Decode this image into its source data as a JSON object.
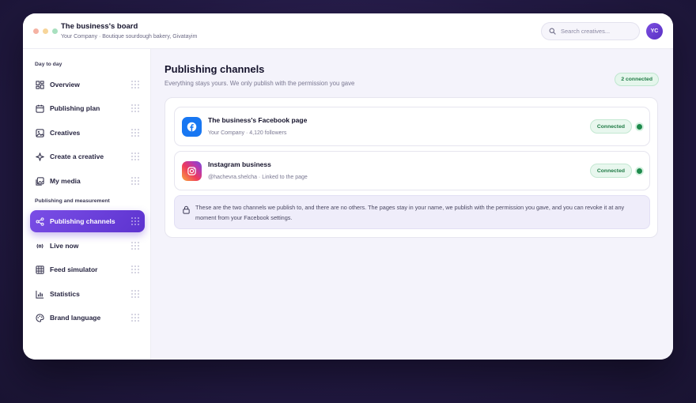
{
  "header": {
    "title": "The business's board",
    "subtitle": "Your Company · Boutique sourdough bakery, Givatayim",
    "search_placeholder": "Search creatives...",
    "avatar_initials": "YC"
  },
  "sidebar": {
    "section_day": "Day to day",
    "section_publishing": "Publishing and measurement",
    "items": [
      {
        "label": "Overview",
        "icon": "dashboard-icon"
      },
      {
        "label": "Publishing plan",
        "icon": "calendar-icon"
      },
      {
        "label": "Creatives",
        "icon": "image-icon"
      },
      {
        "label": "Create a creative",
        "icon": "sparkle-icon"
      },
      {
        "label": "My media",
        "icon": "media-icon"
      },
      {
        "label": "Publishing channels",
        "icon": "share-icon",
        "active": true
      },
      {
        "label": "Live now",
        "icon": "broadcast-icon"
      },
      {
        "label": "Feed simulator",
        "icon": "grid-icon"
      },
      {
        "label": "Statistics",
        "icon": "chart-icon"
      },
      {
        "label": "Brand language",
        "icon": "palette-icon"
      }
    ]
  },
  "main": {
    "title": "Publishing channels",
    "subtitle": "Everything stays yours. We only publish with the permission you gave",
    "connected_count": "2 connected",
    "channels": [
      {
        "name": "The business's Facebook page",
        "meta": "Your Company · 4,120 followers",
        "status": "Connected",
        "icon": "facebook-icon"
      },
      {
        "name": "Instagram business",
        "meta": "@hachevra.shelcha · Linked to the page",
        "status": "Connected",
        "icon": "instagram-icon"
      }
    ],
    "notice": "These are the two channels we publish to, and there are no others. The pages stay in your name, we publish with the permission you gave, and you can revoke it at any moment from your Facebook settings."
  },
  "colors": {
    "accent": "#6a3fdc",
    "success": "#1f7a45",
    "facebook": "#1877f2"
  }
}
